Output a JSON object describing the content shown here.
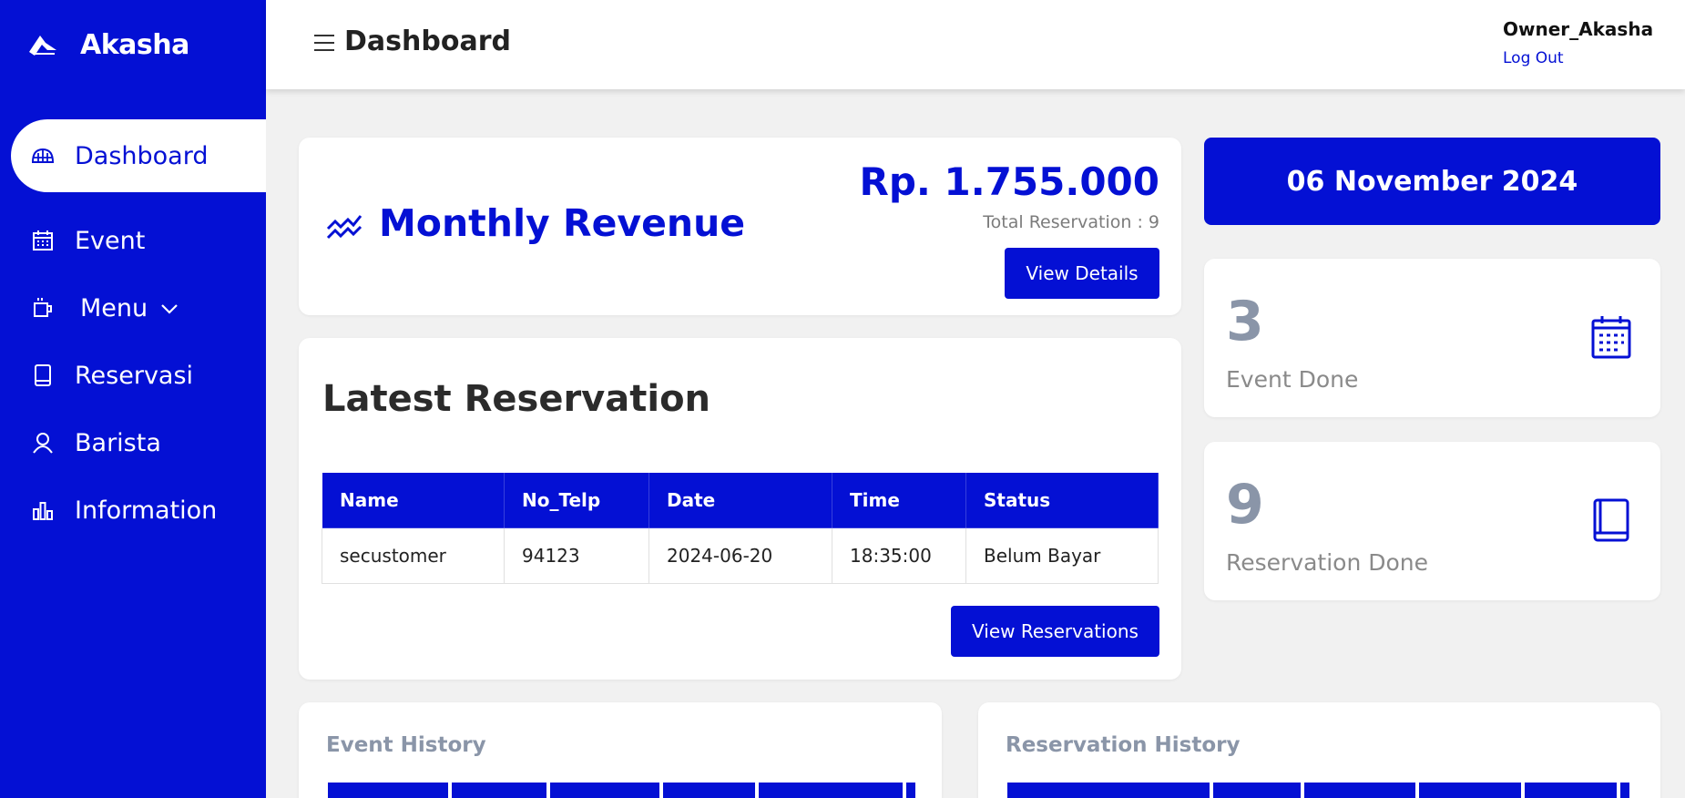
{
  "sidebar": {
    "brand": "Akasha",
    "items": [
      {
        "label": "Dashboard",
        "icon": "dashboard-dome-icon",
        "active": true
      },
      {
        "label": "Event",
        "icon": "calendar-icon"
      },
      {
        "label": "Menu",
        "icon": "coffee-cup-icon",
        "has_dropdown": true
      },
      {
        "label": "Reservasi",
        "icon": "book-icon"
      },
      {
        "label": "Barista",
        "icon": "user-icon"
      },
      {
        "label": "Information",
        "icon": "bar-chart-icon"
      }
    ]
  },
  "topbar": {
    "title": "Dashboard",
    "user": "Owner_Akasha",
    "logout": "Log Out"
  },
  "revenue": {
    "title": "Monthly Revenue",
    "amount": "Rp. 1.755.000",
    "total_reservation": "Total Reservation : 9",
    "button": "View Details"
  },
  "latest": {
    "title": "Latest Reservation",
    "columns": [
      "Name",
      "No_Telp",
      "Date",
      "Time",
      "Status"
    ],
    "rows": [
      [
        "secustomer",
        "94123",
        "2024-06-20",
        "18:35:00",
        "Belum Bayar"
      ]
    ],
    "button": "View Reservations"
  },
  "date": "06 November 2024",
  "stats": {
    "events": {
      "value": "3",
      "label": "Event Done"
    },
    "reservations": {
      "value": "9",
      "label": "Reservation Done"
    }
  },
  "history": {
    "event_title": "Event History",
    "reservation_title": "Reservation History"
  },
  "colors": {
    "primary": "#0410d4",
    "background": "#f1f1f1",
    "muted": "#8a95a8"
  }
}
